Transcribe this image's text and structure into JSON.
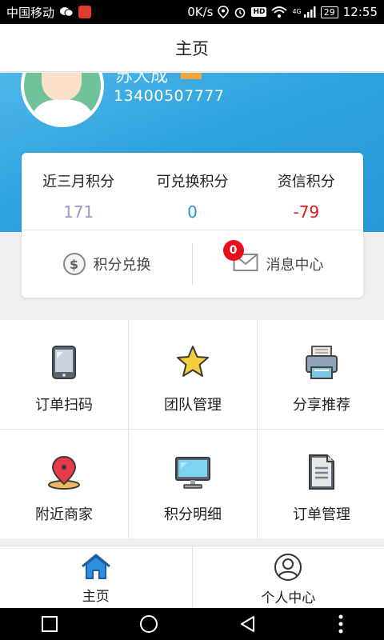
{
  "status_bar": {
    "carrier": "中国移动",
    "speed": "0K/s",
    "hd": "HD",
    "network": "4G",
    "battery": "29",
    "time": "12:55"
  },
  "title_bar": {
    "title": "主页"
  },
  "profile": {
    "name": "苏大成",
    "phone": "13400507777"
  },
  "stats": [
    {
      "label": "近三月积分",
      "value": "171",
      "color": "#9a9ac8"
    },
    {
      "label": "可兑换积分",
      "value": "0",
      "color": "#2a96d8"
    },
    {
      "label": "资信积分",
      "value": "-79",
      "color": "#e0151b"
    }
  ],
  "actions": {
    "exchange_label": "积分兑换",
    "message_label": "消息中心",
    "message_count": "0"
  },
  "grid": [
    {
      "label": "订单扫码",
      "icon": "tablet-icon"
    },
    {
      "label": "团队管理",
      "icon": "star-icon"
    },
    {
      "label": "分享推荐",
      "icon": "printer-icon"
    },
    {
      "label": "附近商家",
      "icon": "location-pin-icon"
    },
    {
      "label": "积分明细",
      "icon": "monitor-icon"
    },
    {
      "label": "订单管理",
      "icon": "document-icon"
    }
  ],
  "tabs": [
    {
      "label": "主页",
      "icon": "home-icon"
    },
    {
      "label": "个人中心",
      "icon": "person-icon"
    }
  ],
  "colors": {
    "primary_blue": "#2fa2df",
    "badge_red": "#e8101b"
  }
}
